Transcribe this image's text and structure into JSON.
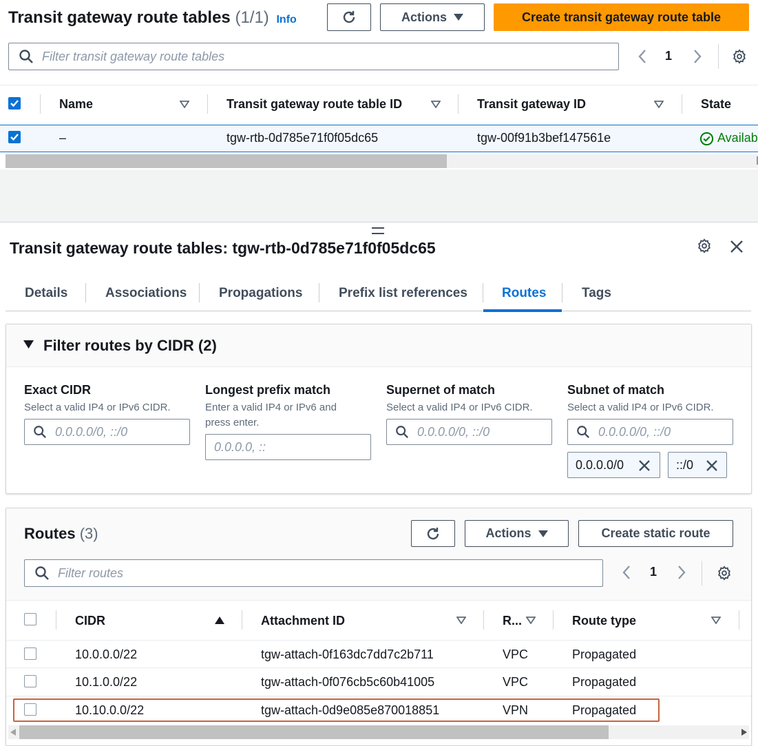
{
  "top": {
    "title": "Transit gateway route tables",
    "count": "(1/1)",
    "info": "Info",
    "actions_label": "Actions",
    "create_label": "Create transit gateway route table",
    "search_placeholder": "Filter transit gateway route tables",
    "page": "1",
    "columns": [
      "Name",
      "Transit gateway route table ID",
      "Transit gateway ID",
      "State"
    ],
    "row": {
      "name": "–",
      "route_table_id": "tgw-rtb-0d785e71f0f05dc65",
      "gateway_id": "tgw-00f91b3bef147561e",
      "state": "Availab"
    }
  },
  "details": {
    "title": "Transit gateway route tables: tgw-rtb-0d785e71f0f05dc65",
    "tabs": [
      "Details",
      "Associations",
      "Propagations",
      "Prefix list references",
      "Routes",
      "Tags"
    ],
    "active_tab": "Routes"
  },
  "filter": {
    "title": "Filter routes by CIDR (2)",
    "fields": [
      {
        "label": "Exact CIDR",
        "hint": "Select a valid IP4 or IPv6 CIDR.",
        "placeholder": "0.0.0.0/0, ::/0"
      },
      {
        "label": "Longest prefix match",
        "hint": "Enter a valid IP4 or IPv6 and press enter.",
        "placeholder": "0.0.0.0, ::"
      },
      {
        "label": "Supernet of match",
        "hint": "Select a valid IP4 or IPv6 CIDR.",
        "placeholder": "0.0.0.0/0, ::/0"
      },
      {
        "label": "Subnet of match",
        "hint": "Select a valid IP4 or IPv6 CIDR.",
        "placeholder": "0.0.0.0/0, ::/0"
      }
    ],
    "tokens": [
      "0.0.0.0/0",
      "::/0"
    ]
  },
  "routes": {
    "title": "Routes",
    "count": "(3)",
    "actions_label": "Actions",
    "create_label": "Create static route",
    "search_placeholder": "Filter routes",
    "page": "1",
    "columns": [
      "CIDR",
      "Attachment ID",
      "R...",
      "Route type"
    ],
    "rows": [
      {
        "cidr": "10.0.0.0/22",
        "attachment": "tgw-attach-0f163dc7dd7c2b711",
        "resource": "VPC",
        "type": "Propagated"
      },
      {
        "cidr": "10.1.0.0/22",
        "attachment": "tgw-attach-0f076cb5c60b41005",
        "resource": "VPC",
        "type": "Propagated"
      },
      {
        "cidr": "10.10.0.0/22",
        "attachment": "tgw-attach-0d9e085e870018851",
        "resource": "VPN",
        "type": "Propagated"
      }
    ]
  },
  "colors": {
    "primary": "#ff9900",
    "link": "#0972d3",
    "success": "#037f0c",
    "highlight": "#c7643f"
  }
}
